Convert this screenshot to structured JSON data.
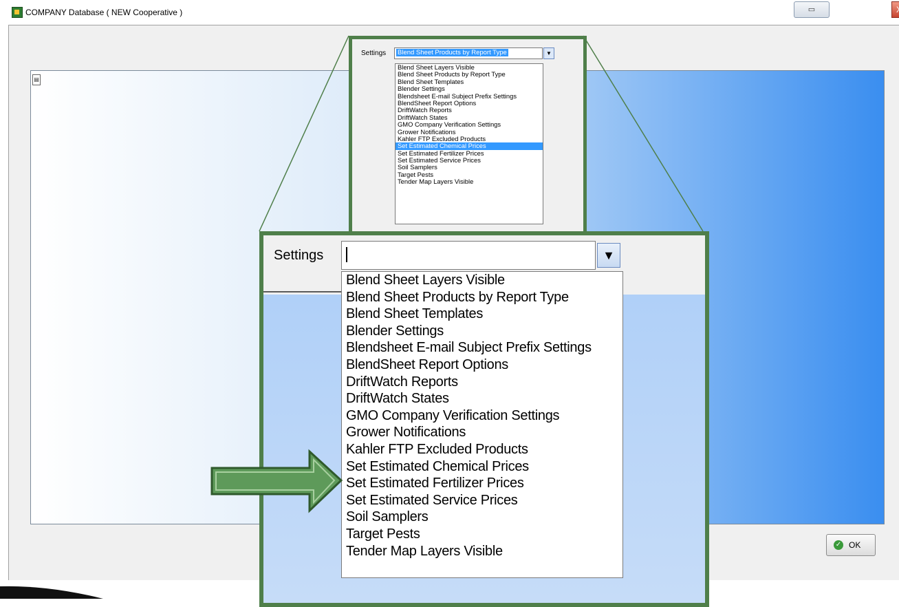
{
  "window": {
    "title": "COMPANY Database ( NEW Cooperative )",
    "restore_label": "▭",
    "close_label": "X",
    "ok_label": "OK"
  },
  "settings": {
    "label": "Settings",
    "small_selected_value": "Blend Sheet Products by Report Type",
    "big_current_value": "",
    "items": [
      "Blend Sheet Layers Visible",
      "Blend Sheet Products by Report Type",
      "Blend Sheet Templates",
      "Blender Settings",
      "Blendsheet E-mail Subject Prefix Settings",
      "BlendSheet Report Options",
      "DriftWatch Reports",
      "DriftWatch States",
      "GMO Company Verification Settings",
      "Grower Notifications",
      "Kahler FTP Excluded Products",
      "Set Estimated Chemical Prices",
      "Set Estimated Fertilizer Prices",
      "Set Estimated Service Prices",
      "Soil Samplers",
      "Target Pests",
      "Tender Map Layers Visible"
    ],
    "highlighted_item": "Set Estimated Chemical Prices"
  },
  "colors": {
    "callout_green": "#4f7f4a",
    "selection_blue": "#3399ff",
    "arrow_green": "#5e9a5a"
  },
  "icons": {
    "app": "app-icon",
    "dropdown": "chevron-down-icon",
    "ok": "check-icon",
    "pointer": "green-arrow-icon"
  }
}
